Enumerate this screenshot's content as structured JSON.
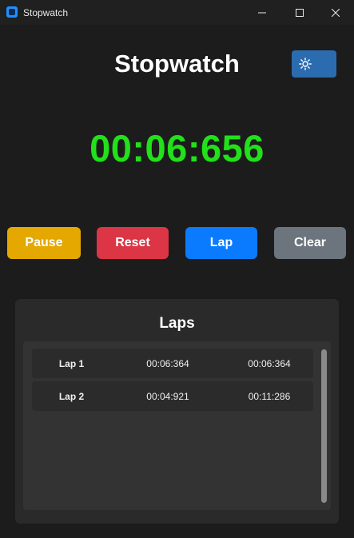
{
  "window": {
    "title": "Stopwatch"
  },
  "header": {
    "title": "Stopwatch",
    "theme_toggle_icon": "sun-icon"
  },
  "timer": {
    "display": "00:06:656"
  },
  "controls": {
    "pause_label": "Pause",
    "reset_label": "Reset",
    "lap_label": "Lap",
    "clear_label": "Clear"
  },
  "laps": {
    "title": "Laps",
    "items": [
      {
        "label": "Lap 1",
        "lap_time": "00:06:364",
        "total_time": "00:06:364"
      },
      {
        "label": "Lap 2",
        "lap_time": "00:04:921",
        "total_time": "00:11:286"
      }
    ]
  },
  "colors": {
    "background": "#1c1c1c",
    "timer_text": "#22e01a",
    "pause": "#e4a800",
    "reset": "#dc3545",
    "lap": "#0a7bff",
    "clear": "#6c757d",
    "theme_toggle": "#2b6cb0"
  }
}
